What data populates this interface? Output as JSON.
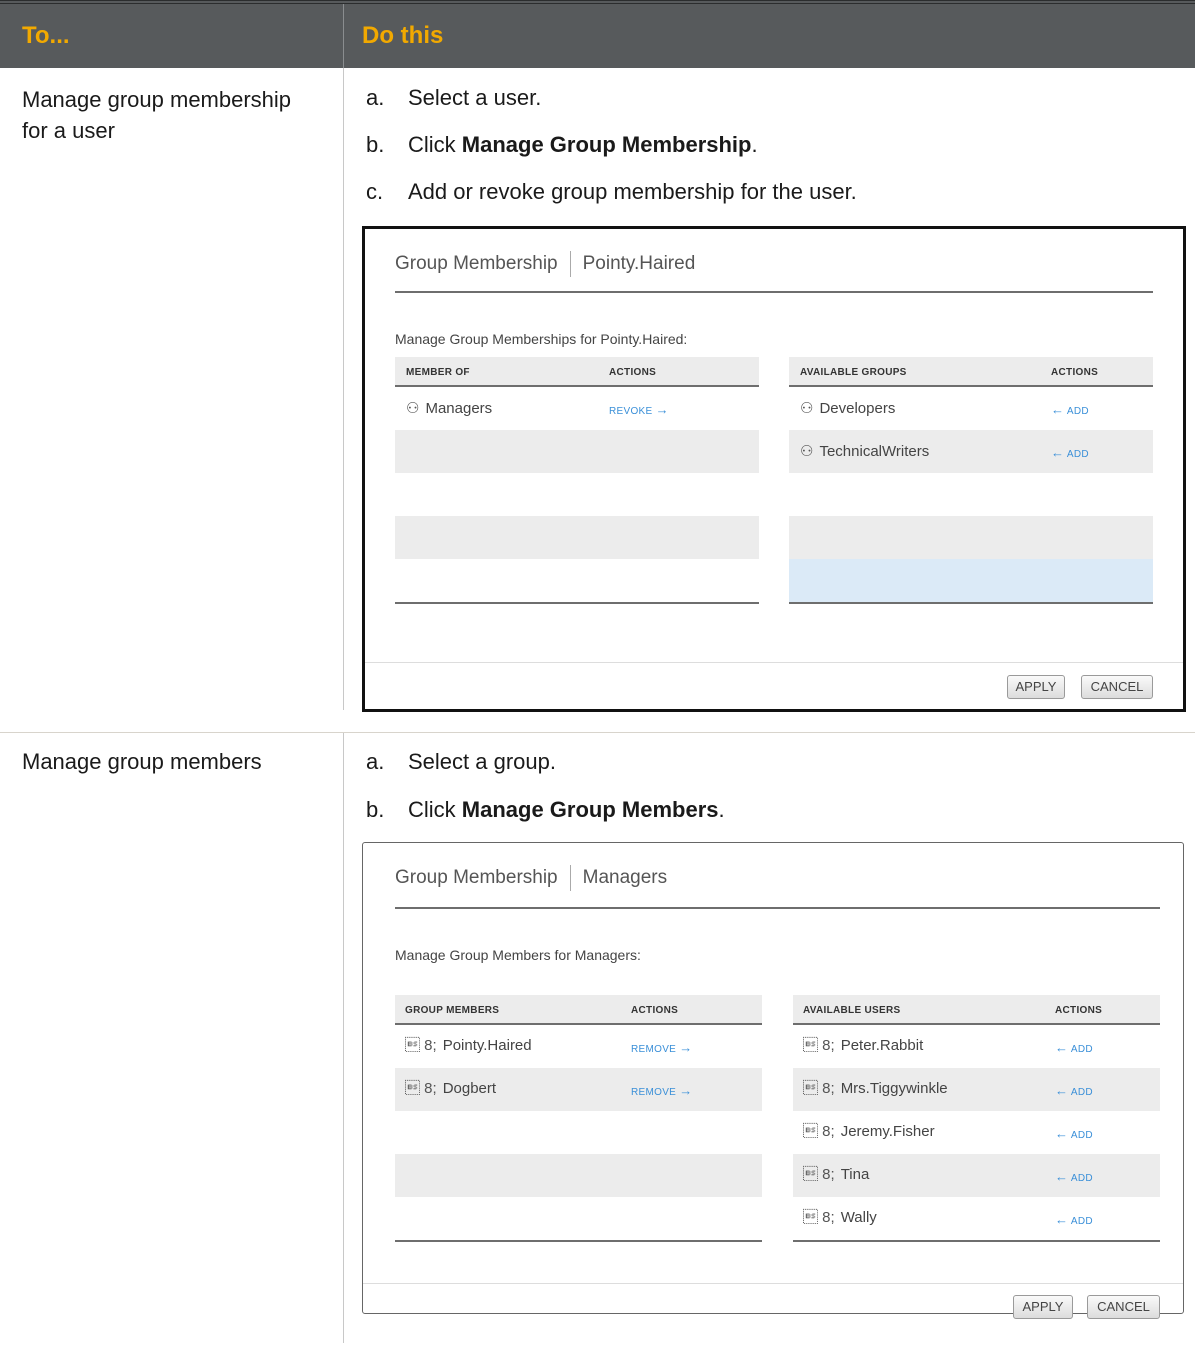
{
  "table": {
    "header": {
      "col1": "To...",
      "col2": "Do this"
    },
    "rows": [
      {
        "label_line1": "Manage group membership",
        "label_line2": "for a user",
        "steps": [
          {
            "letter": "a.",
            "text": "Select a user."
          },
          {
            "letter": "b.",
            "text_pre": "Click ",
            "bold": "Manage Group Membership",
            "text_post": "."
          },
          {
            "letter": "c.",
            "text": "Add or revoke group membership for the user."
          }
        ],
        "dialog": {
          "title": "Group Membership",
          "subject": "Pointy.Haired",
          "subtitle": "Manage Group Memberships for Pointy.Haired:",
          "left": {
            "col_name": "MEMBER OF",
            "col_actions": "ACTIONS",
            "items": [
              {
                "name": "Managers",
                "action": "REVOKE"
              }
            ]
          },
          "right": {
            "col_name": "AVAILABLE GROUPS",
            "col_actions": "ACTIONS",
            "items": [
              {
                "name": "Developers",
                "action": "ADD"
              },
              {
                "name": "TechnicalWriters",
                "action": "ADD"
              }
            ]
          },
          "apply": "APPLY",
          "cancel": "CANCEL"
        }
      },
      {
        "label_line1": "Manage group members",
        "steps": [
          {
            "letter": "a.",
            "text": "Select a group."
          },
          {
            "letter": "b.",
            "text_pre": "Click ",
            "bold": "Manage Group Members",
            "text_post": "."
          }
        ],
        "dialog": {
          "title": "Group Membership",
          "subject": "Managers",
          "subtitle": "Manage Group Members for Managers:",
          "left": {
            "col_name": "GROUP MEMBERS",
            "col_actions": "ACTIONS",
            "items": [
              {
                "name": "Pointy.Haired",
                "action": "REMOVE"
              },
              {
                "name": "Dogbert",
                "action": "REMOVE"
              }
            ]
          },
          "right": {
            "col_name": "AVAILABLE USERS",
            "col_actions": "ACTIONS",
            "items": [
              {
                "name": "Peter.Rabbit",
                "action": "ADD"
              },
              {
                "name": "Mrs.Tiggywinkle",
                "action": "ADD"
              },
              {
                "name": "Jeremy.Fisher",
                "action": "ADD"
              },
              {
                "name": "Tina",
                "action": "ADD"
              },
              {
                "name": "Wally",
                "action": "ADD"
              }
            ]
          },
          "apply": "APPLY",
          "cancel": "CANCEL"
        }
      }
    ]
  },
  "icons": {
    "group": "group-icon",
    "user": "user-icon",
    "arrow_right": "arrow-right-icon",
    "arrow_left": "arrow-left-icon"
  },
  "colors": {
    "header_bg": "#575a5c",
    "header_text": "#f2a900",
    "link": "#3a8fd8",
    "row_gray": "#ececec",
    "row_selected": "#dbeaf7"
  }
}
